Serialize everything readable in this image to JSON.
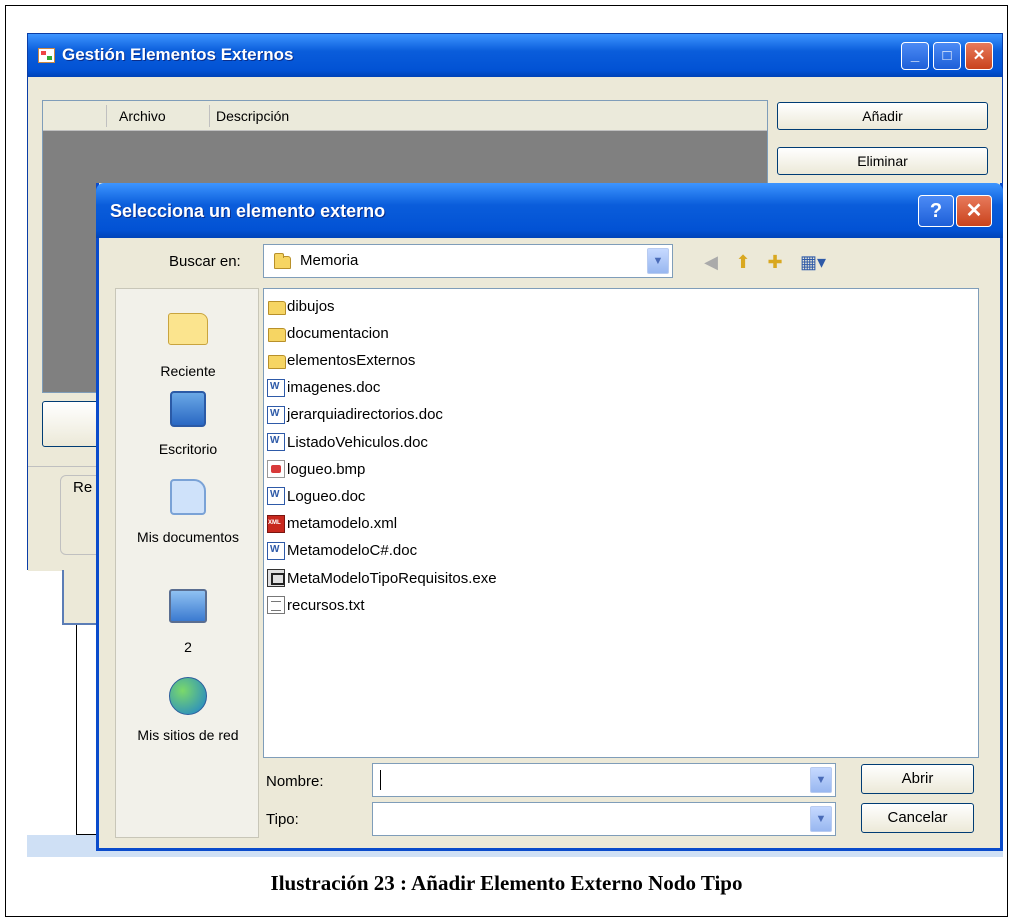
{
  "background_window": {
    "title": "Gestión Elementos Externos",
    "grid_columns": [
      "Archivo",
      "Descripción"
    ],
    "buttons": [
      "Añadir",
      "Eliminar"
    ],
    "partial_label": "Re"
  },
  "dialog": {
    "title": "Selecciona un elemento externo",
    "help_glyph": "?",
    "close_glyph": "✕",
    "look_in_label": "Buscar en:",
    "look_in_value": "Memoria",
    "places": [
      "Reciente",
      "Escritorio",
      "Mis documentos",
      "2",
      "Mis sitios de red"
    ],
    "files": [
      {
        "name": "dibujos",
        "type": "folder"
      },
      {
        "name": "documentacion",
        "type": "folder"
      },
      {
        "name": "elementosExternos",
        "type": "folder"
      },
      {
        "name": "imagenes.doc",
        "type": "doc"
      },
      {
        "name": "jerarquiadirectorios.doc",
        "type": "doc"
      },
      {
        "name": "ListadoVehiculos.doc",
        "type": "doc"
      },
      {
        "name": "logueo.bmp",
        "type": "bmp"
      },
      {
        "name": "Logueo.doc",
        "type": "doc"
      },
      {
        "name": "metamodelo.xml",
        "type": "xml"
      },
      {
        "name": "MetamodeloC#.doc",
        "type": "doc"
      },
      {
        "name": "MetaModeloTipoRequisitos.exe",
        "type": "exe"
      },
      {
        "name": "recursos.txt",
        "type": "txt"
      }
    ],
    "filename_label": "Nombre:",
    "filename_value": "",
    "filetype_label": "Tipo:",
    "filetype_value": "",
    "open_button": "Abrir",
    "cancel_button": "Cancelar"
  },
  "caption": "Ilustración 23 : Añadir Elemento Externo Nodo Tipo",
  "colors": {
    "titlebar": "#0a5ddb",
    "window_face": "#ece9d8",
    "grid_bg": "#808080"
  }
}
